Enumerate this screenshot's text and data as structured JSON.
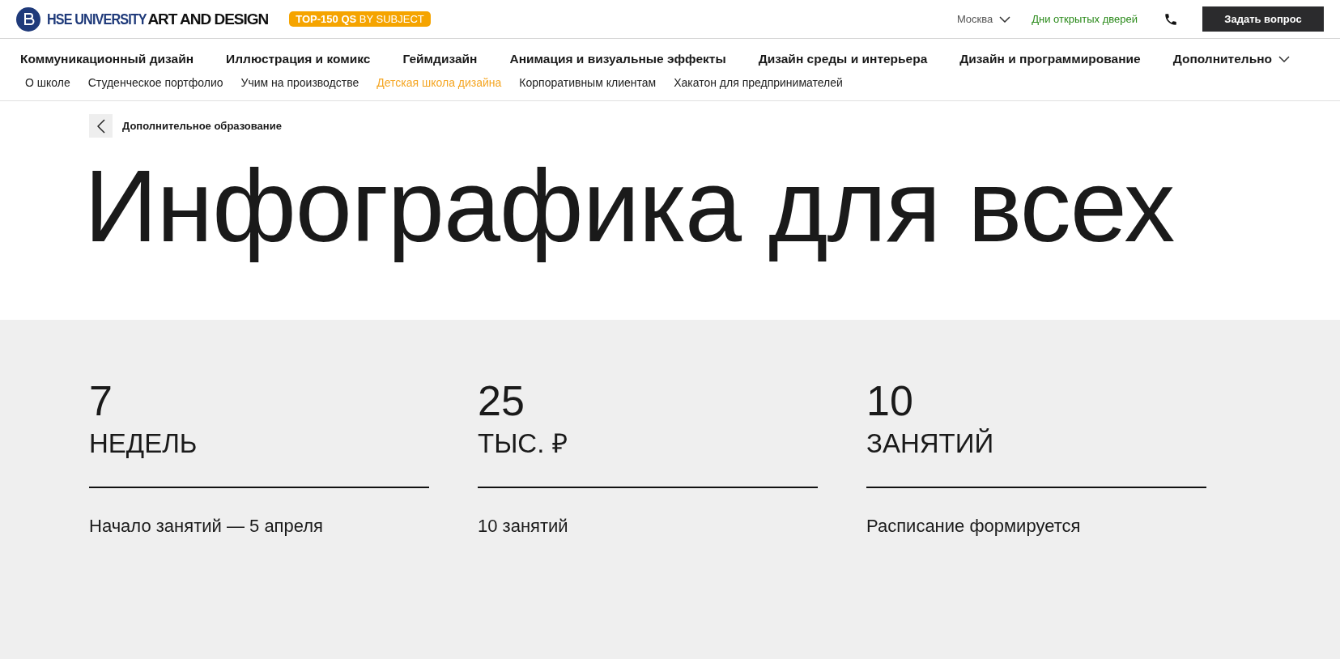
{
  "header": {
    "logo_primary": "HSE UNIVERSITY",
    "logo_secondary": "ART AND DESIGN",
    "badge": "**TOP-150 QS** BY SUBJECT",
    "city": "Москва",
    "open_days": "Дни открытых дверей",
    "ask_button": "Задать вопрос"
  },
  "main_nav": [
    {
      "label": "Коммуникационный дизайн",
      "dropdown": false
    },
    {
      "label": "Иллюстрация и комикс",
      "dropdown": false
    },
    {
      "label": "Геймдизайн",
      "dropdown": false
    },
    {
      "label": "Анимация и визуальные эффекты",
      "dropdown": false
    },
    {
      "label": "Дизайн среды и интерьера",
      "dropdown": false
    },
    {
      "label": "Дизайн и программирование",
      "dropdown": false
    },
    {
      "label": "Дополнительно",
      "dropdown": true
    }
  ],
  "sub_nav": [
    {
      "label": "О школе",
      "selected": false
    },
    {
      "label": "Студенческое портфолио",
      "selected": false
    },
    {
      "label": "Учим на производстве",
      "selected": false
    },
    {
      "label": "Детская школа дизайна",
      "selected": true
    },
    {
      "label": "Корпоративным клиентам",
      "selected": false
    },
    {
      "label": "Хакатон для предпринимателей",
      "selected": false
    }
  ],
  "breadcrumb": "Дополнительное образование",
  "title": "Инфографика для всех",
  "stats": [
    {
      "value": "7",
      "unit": "НЕДЕЛЬ",
      "note": "Начало занятий — 5 апреля"
    },
    {
      "value": "25",
      "unit": "ТЫС. ₽",
      "note": "10 занятий"
    },
    {
      "value": "10",
      "unit": "ЗАНЯТИЙ",
      "note": "Расписание формируется"
    }
  ]
}
